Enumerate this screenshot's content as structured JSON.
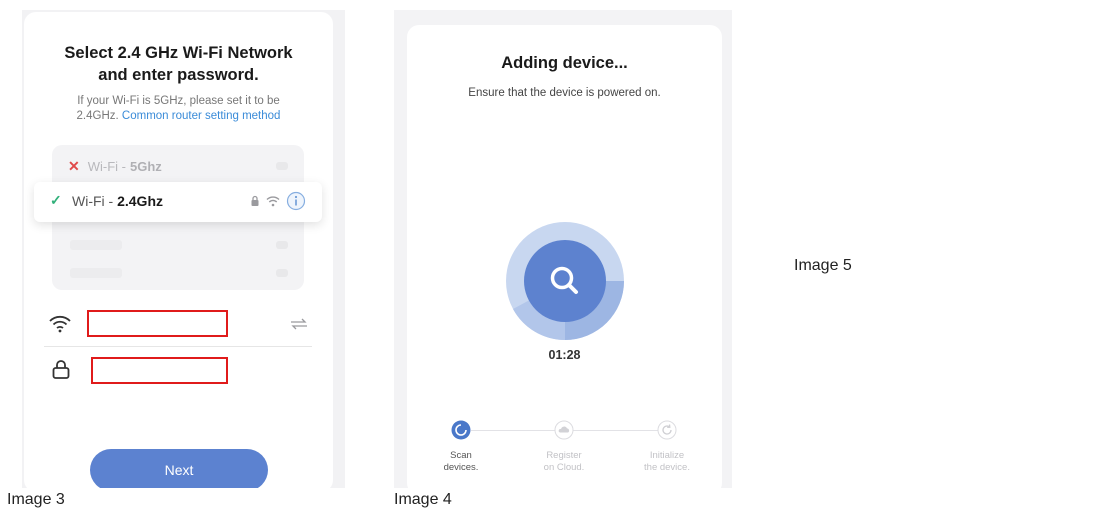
{
  "captions": {
    "image3": "Image 3",
    "image4": "Image 4",
    "image5": "Image 5"
  },
  "screen1": {
    "title_line1": "Select 2.4 GHz Wi-Fi Network",
    "title_line2": "and enter password.",
    "hint_line1": "If your Wi-Fi is 5GHz, please set it to be",
    "hint_prefix": "2.4GHz.",
    "hint_link": "Common router setting method",
    "networks": [
      {
        "prefix": "Wi-Fi -",
        "band": "5Ghz",
        "status_icon": "close-icon"
      },
      {
        "prefix": "Wi-Fi -",
        "band": "2.4Ghz",
        "status_icon": "check-icon"
      }
    ],
    "next_label": "Next"
  },
  "screen2": {
    "title": "Adding device...",
    "subtitle": "Ensure that the device is powered on.",
    "timer": "01:28",
    "steps": [
      {
        "line1": "Scan",
        "line2": "devices.",
        "active": true,
        "icon": "loading-icon"
      },
      {
        "line1": "Register",
        "line2": "on Cloud.",
        "active": false,
        "icon": "cloud-icon"
      },
      {
        "line1": "Initialize",
        "line2": "the device.",
        "active": false,
        "icon": "refresh-icon"
      }
    ]
  },
  "colors": {
    "accent_blue": "#5c82d0",
    "link_blue": "#3a8bd8",
    "check_green": "#31b07a",
    "error_red": "#e04a4a",
    "highlight_red": "#e01b1b"
  }
}
